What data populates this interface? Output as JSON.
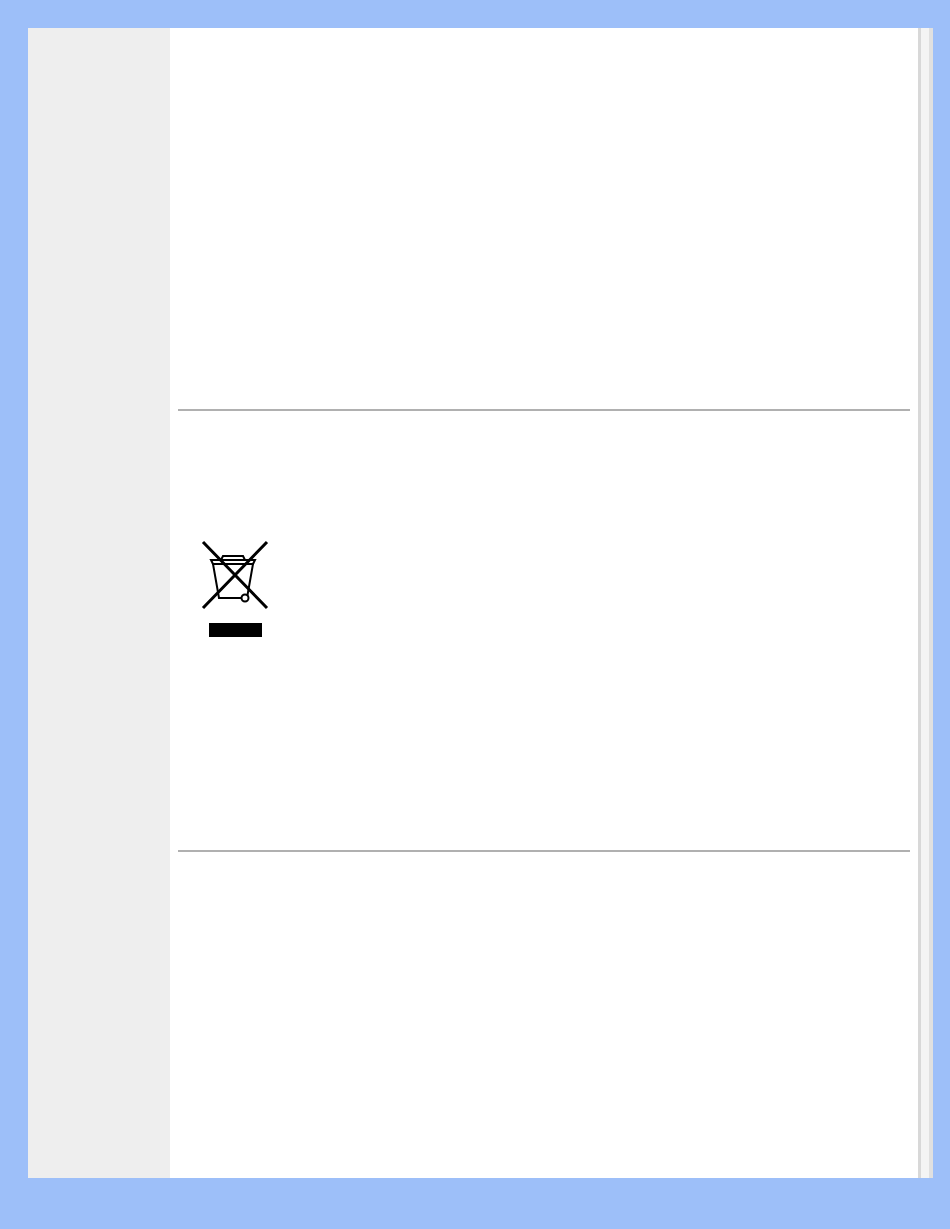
{
  "sections": [
    {
      "kind": "blank"
    },
    {
      "kind": "weee-symbol"
    },
    {
      "kind": "blank"
    }
  ]
}
